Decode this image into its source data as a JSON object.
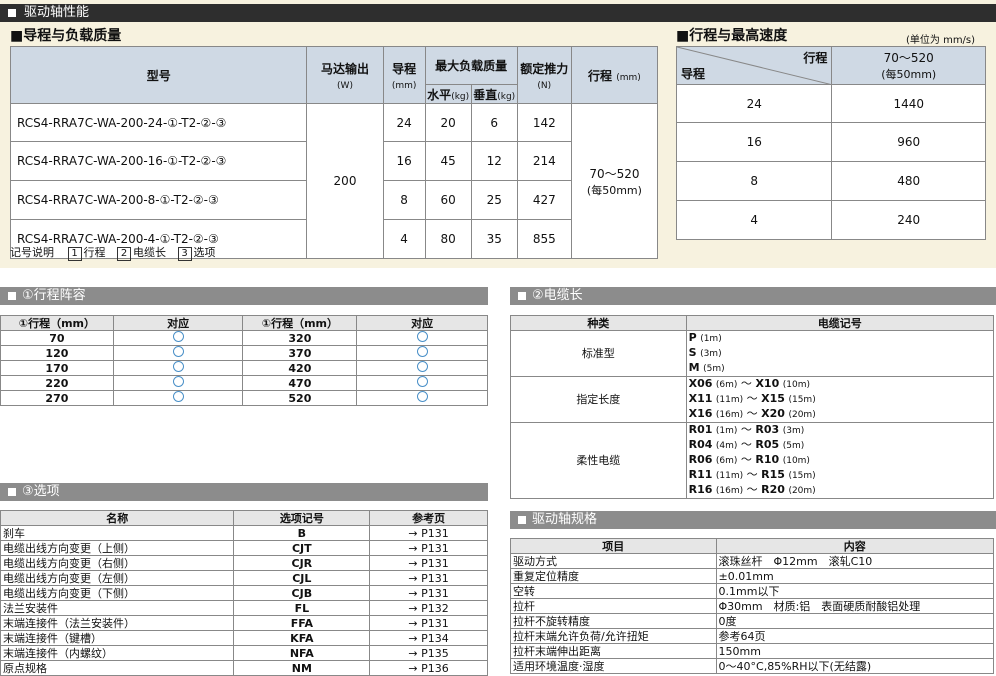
{
  "top": {
    "banner": "驱动轴性能",
    "left_title": "■导程与负载质量",
    "right_title": "■行程与最高速度",
    "unit_note": "(单位为 mm/s)",
    "headers": {
      "model": "型号",
      "motor": "马达输出",
      "motor_unit": "(W)",
      "lead": "导程",
      "lead_unit": "(mm)",
      "maxload": "最大负载质量",
      "horiz": "水平",
      "horiz_unit": "(kg)",
      "vert": "垂直",
      "vert_unit": "(kg)",
      "thrust": "额定推力",
      "thrust_unit": "(N)",
      "stroke": "行程",
      "stroke_unit": "(mm)"
    },
    "motor_value": "200",
    "stroke_value": "70～520",
    "stroke_value_sub": "(每50mm)",
    "rows": [
      {
        "model": "RCS4-RRA7C-WA-200-24-①-T2-②-③",
        "lead": "24",
        "h": "20",
        "v": "6",
        "thrust": "142"
      },
      {
        "model": "RCS4-RRA7C-WA-200-16-①-T2-②-③",
        "lead": "16",
        "h": "45",
        "v": "12",
        "thrust": "214"
      },
      {
        "model": "RCS4-RRA7C-WA-200-8-①-T2-②-③",
        "lead": "8",
        "h": "60",
        "v": "25",
        "thrust": "427"
      },
      {
        "model": "RCS4-RRA7C-WA-200-4-①-T2-②-③",
        "lead": "4",
        "h": "80",
        "v": "35",
        "thrust": "855"
      }
    ],
    "speed_header_stroke": "行程",
    "speed_header_lead": "导程",
    "speed_header_range": "70～520",
    "speed_header_range_sub": "(每50mm)",
    "speed_rows": [
      {
        "lead": "24",
        "speed": "1440"
      },
      {
        "lead": "16",
        "speed": "960"
      },
      {
        "lead": "8",
        "speed": "480"
      },
      {
        "lead": "4",
        "speed": "240"
      }
    ],
    "legend": {
      "label": "记号说明",
      "items": [
        "行程",
        "电缆长",
        "选项"
      ]
    }
  },
  "stroke_section": {
    "banner": "①行程阵容",
    "headers": [
      "①行程（mm）",
      "对应",
      "①行程（mm）",
      "对应"
    ],
    "rows": [
      [
        "70",
        "320"
      ],
      [
        "120",
        "370"
      ],
      [
        "170",
        "420"
      ],
      [
        "220",
        "470"
      ],
      [
        "270",
        "520"
      ]
    ]
  },
  "cable_section": {
    "banner": "②电缆长",
    "headers": [
      "种类",
      "电缆记号"
    ],
    "groups": [
      {
        "name": "标准型",
        "items": [
          {
            "a": "P",
            "al": "(1m)"
          },
          {
            "a": "S",
            "al": "(3m)"
          },
          {
            "a": "M",
            "al": "(5m)"
          }
        ]
      },
      {
        "name": "指定长度",
        "items": [
          {
            "a": "X06",
            "al": "(6m)",
            "b": "X10",
            "bl": "(10m)"
          },
          {
            "a": "X11",
            "al": "(11m)",
            "b": "X15",
            "bl": "(15m)"
          },
          {
            "a": "X16",
            "al": "(16m)",
            "b": "X20",
            "bl": "(20m)"
          }
        ]
      },
      {
        "name": "柔性电缆",
        "items": [
          {
            "a": "R01",
            "al": "(1m)",
            "b": "R03",
            "bl": "(3m)"
          },
          {
            "a": "R04",
            "al": "(4m)",
            "b": "R05",
            "bl": "(5m)"
          },
          {
            "a": "R06",
            "al": "(6m)",
            "b": "R10",
            "bl": "(10m)"
          },
          {
            "a": "R11",
            "al": "(11m)",
            "b": "R15",
            "bl": "(15m)"
          },
          {
            "a": "R16",
            "al": "(16m)",
            "b": "R20",
            "bl": "(20m)"
          }
        ]
      }
    ]
  },
  "option_section": {
    "banner": "③选项",
    "headers": [
      "名称",
      "选项记号",
      "参考页"
    ],
    "rows": [
      [
        "刹车",
        "B",
        "→ P131"
      ],
      [
        "电缆出线方向变更（上侧）",
        "CJT",
        "→ P131"
      ],
      [
        "电缆出线方向变更（右侧）",
        "CJR",
        "→ P131"
      ],
      [
        "电缆出线方向变更（左侧）",
        "CJL",
        "→ P131"
      ],
      [
        "电缆出线方向变更（下侧）",
        "CJB",
        "→ P131"
      ],
      [
        "法兰安装件",
        "FL",
        "→ P132"
      ],
      [
        "末端连接件（法兰安装件）",
        "FFA",
        "→ P131"
      ],
      [
        "末端连接件（键槽）",
        "KFA",
        "→ P134"
      ],
      [
        "末端连接件（内螺纹）",
        "NFA",
        "→ P135"
      ],
      [
        "原点规格",
        "NM",
        "→ P136"
      ]
    ]
  },
  "spec_section": {
    "banner": "驱动轴规格",
    "headers": [
      "项目",
      "内容"
    ],
    "rows": [
      [
        "驱动方式",
        "滚珠丝杆　Φ12mm　滚轧C10"
      ],
      [
        "重复定位精度",
        "±0.01mm"
      ],
      [
        "空转",
        "0.1mm以下"
      ],
      [
        "拉杆",
        "Φ30mm　材质:铝　表面硬质耐酸铝处理"
      ],
      [
        "拉杆不旋转精度",
        "0度"
      ],
      [
        "拉杆末端允许负荷/允许扭矩",
        "参考64页"
      ],
      [
        "拉杆末端伸出距离",
        "150mm"
      ],
      [
        "适用环境温度·湿度",
        "0～40°C,85%RH以下(无结露)"
      ]
    ]
  }
}
